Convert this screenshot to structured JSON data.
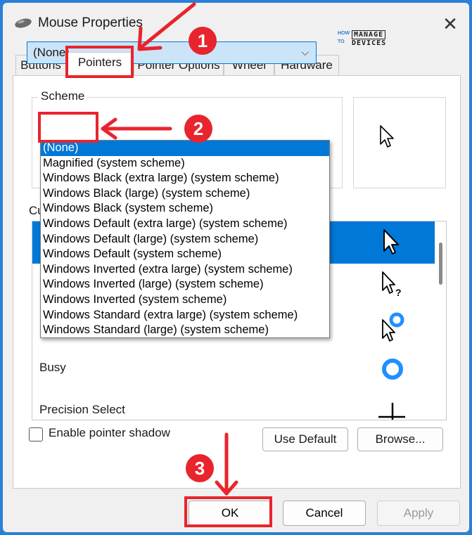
{
  "window": {
    "title": "Mouse Properties",
    "close_glyph": "✕"
  },
  "brand": {
    "how": "HOW",
    "to": "TO",
    "manage": "MANAGE",
    "devices": "DEVICES"
  },
  "tabs": [
    {
      "label": "Buttons"
    },
    {
      "label": "Pointers",
      "active": true
    },
    {
      "label": "Pointer Options"
    },
    {
      "label": "Wheel"
    },
    {
      "label": "Hardware"
    }
  ],
  "scheme": {
    "label": "Scheme",
    "selected": "(None)",
    "options": [
      "(None)",
      "Magnified (system scheme)",
      "Windows Black (extra large) (system scheme)",
      "Windows Black (large) (system scheme)",
      "Windows Black (system scheme)",
      "Windows Default (extra large) (system scheme)",
      "Windows Default (large) (system scheme)",
      "Windows Default (system scheme)",
      "Windows Inverted (extra large) (system scheme)",
      "Windows Inverted (large) (system scheme)",
      "Windows Inverted (system scheme)",
      "Windows Standard (extra large) (system scheme)",
      "Windows Standard (large) (system scheme)"
    ]
  },
  "customize": {
    "label": "Cu",
    "rows": [
      {
        "name": "",
        "icon": "arrow-cursor-icon",
        "selected": true
      },
      {
        "name": "",
        "icon": "help-cursor-icon"
      },
      {
        "name": "",
        "icon": "working-cursor-icon"
      },
      {
        "name": "Busy",
        "icon": "busy-ring-icon"
      },
      {
        "name": "Precision Select",
        "icon": "crosshair-icon"
      }
    ]
  },
  "shadow": {
    "label": "Enable pointer shadow",
    "checked": false
  },
  "buttons": {
    "use_default": "Use Default",
    "browse": "Browse...",
    "ok": "OK",
    "cancel": "Cancel",
    "apply": "Apply"
  },
  "annotations": {
    "badge1": "1",
    "badge2": "2",
    "badge3": "3",
    "color": "#e8242c"
  },
  "colors": {
    "selection": "#0078d7",
    "frame": "#2a7fd6"
  }
}
